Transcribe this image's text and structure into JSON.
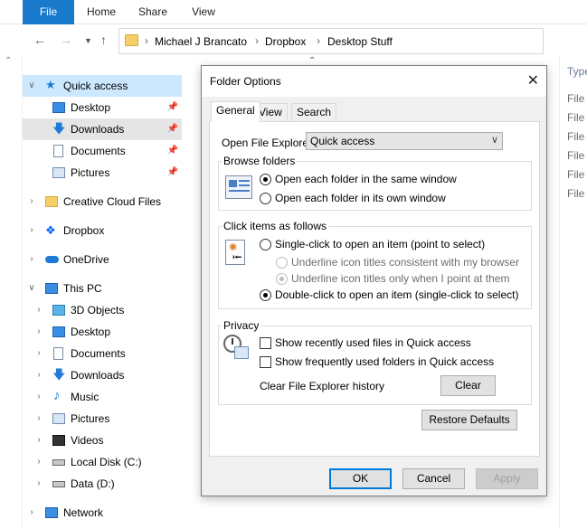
{
  "ribbon": {
    "tabs": [
      "File",
      "Home",
      "Share",
      "View"
    ]
  },
  "address": {
    "crumbs": [
      "Michael J Brancato",
      "Dropbox",
      "Desktop Stuff"
    ]
  },
  "nav": {
    "quick_access": "Quick access",
    "quick_items": [
      "Desktop",
      "Downloads",
      "Documents",
      "Pictures"
    ],
    "creative_cloud": "Creative Cloud Files",
    "dropbox": "Dropbox",
    "onedrive": "OneDrive",
    "this_pc": "This PC",
    "pc_items": [
      "3D Objects",
      "Desktop",
      "Documents",
      "Downloads",
      "Music",
      "Pictures",
      "Videos",
      "Local Disk (C:)",
      "Data (D:)"
    ],
    "network": "Network"
  },
  "right_column": {
    "header": "Type",
    "rows": [
      "File",
      "File",
      "File",
      "File",
      "File",
      "File"
    ]
  },
  "dialog": {
    "title": "Folder Options",
    "tabs": [
      "General",
      "View",
      "Search"
    ],
    "open_label": "Open File Explorer to:",
    "open_value": "Quick access",
    "browse": {
      "legend": "Browse folders",
      "opt_same": "Open each folder in the same window",
      "opt_own": "Open each folder in its own window"
    },
    "click": {
      "legend": "Click items as follows",
      "single": "Single-click to open an item (point to select)",
      "underline_browser": "Underline icon titles consistent with my browser",
      "underline_point": "Underline icon titles only when I point at them",
      "double": "Double-click to open an item (single-click to select)"
    },
    "privacy": {
      "legend": "Privacy",
      "recent_files": "Show recently used files in Quick access",
      "frequent_folders": "Show frequently used folders in Quick access",
      "clear_label": "Clear File Explorer history",
      "clear_button": "Clear"
    },
    "restore_button": "Restore Defaults",
    "ok": "OK",
    "cancel": "Cancel",
    "apply": "Apply"
  },
  "colors": {
    "accent": "#1979ca",
    "selection": "#cce8ff",
    "hover": "#e5e5e5"
  }
}
